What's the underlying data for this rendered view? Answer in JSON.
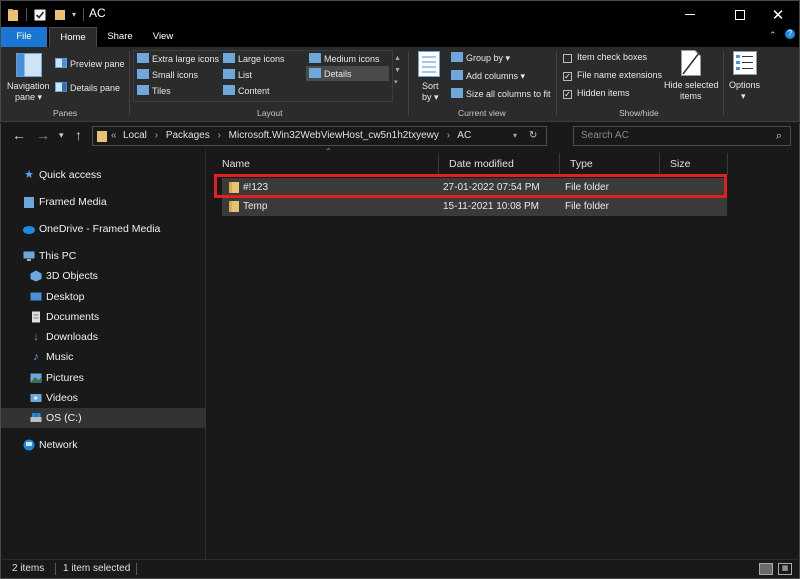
{
  "window": {
    "title": "AC",
    "minimize_icon": "minimize-icon",
    "maximize_icon": "maximize-icon",
    "close_icon": "close-icon"
  },
  "tabs": [
    {
      "label": "File"
    },
    {
      "label": "Home"
    },
    {
      "label": "Share"
    },
    {
      "label": "View"
    }
  ],
  "ribbon": {
    "panes": {
      "group_label": "Panes",
      "navigation_pane": "Navigation",
      "navigation_pane_2": "pane",
      "preview_pane": "Preview pane",
      "details_pane": "Details pane"
    },
    "layout": {
      "group_label": "Layout",
      "items": [
        "Extra large icons",
        "Large icons",
        "Medium icons",
        "Small icons",
        "List",
        "Details",
        "Tiles",
        "Content"
      ],
      "selected": "Details"
    },
    "current_view": {
      "group_label": "Current view",
      "sort_by": "Sort",
      "sort_by_2": "by",
      "group_by": "Group by",
      "add_columns": "Add columns",
      "size_all_columns": "Size all columns to fit"
    },
    "show_hide": {
      "group_label": "Show/hide",
      "item_check_boxes": "Item check boxes",
      "file_name_extensions": "File name extensions",
      "hidden_items": "Hidden items",
      "item_check_boxes_checked": false,
      "file_name_extensions_checked": true,
      "hidden_items_checked": true,
      "hide_selected_items": "Hide selected",
      "hide_selected_items_2": "items"
    },
    "options": {
      "label": "Options"
    }
  },
  "address_bar": {
    "breadcrumb_prefix": "«",
    "crumbs": [
      "Local",
      "Packages",
      "Microsoft.Win32WebViewHost_cw5n1h2txyewy",
      "AC"
    ],
    "search_placeholder": "Search AC"
  },
  "nav_pane": {
    "items": [
      {
        "label": "Quick access",
        "icon": "star-icon"
      },
      {
        "label": "Framed Media",
        "icon": "folder-icon"
      },
      {
        "label": "OneDrive - Framed Media",
        "icon": "cloud-icon"
      },
      {
        "label": "This PC",
        "icon": "computer-icon"
      },
      {
        "label": "3D Objects",
        "icon": "cube-icon"
      },
      {
        "label": "Desktop",
        "icon": "desktop-icon"
      },
      {
        "label": "Documents",
        "icon": "document-icon"
      },
      {
        "label": "Downloads",
        "icon": "download-icon"
      },
      {
        "label": "Music",
        "icon": "music-icon"
      },
      {
        "label": "Pictures",
        "icon": "picture-icon"
      },
      {
        "label": "Videos",
        "icon": "video-icon"
      },
      {
        "label": "OS (C:)",
        "icon": "drive-icon"
      },
      {
        "label": "Network",
        "icon": "network-icon"
      }
    ],
    "selected": "OS (C:)"
  },
  "file_list": {
    "columns": [
      "Name",
      "Date modified",
      "Type",
      "Size"
    ],
    "rows": [
      {
        "name": "#!123",
        "date_modified": "27-01-2022 07:54 PM",
        "type": "File folder",
        "size": ""
      },
      {
        "name": "Temp",
        "date_modified": "15-11-2021 10:08 PM",
        "type": "File folder",
        "size": ""
      }
    ],
    "highlighted_row": "#!123",
    "highlight_color": "#e0201e"
  },
  "status_bar": {
    "item_count": "2 items",
    "selection": "1 item selected"
  },
  "colors": {
    "accent": "#1976d2",
    "folder": "#e8c270",
    "background": "#191919"
  }
}
